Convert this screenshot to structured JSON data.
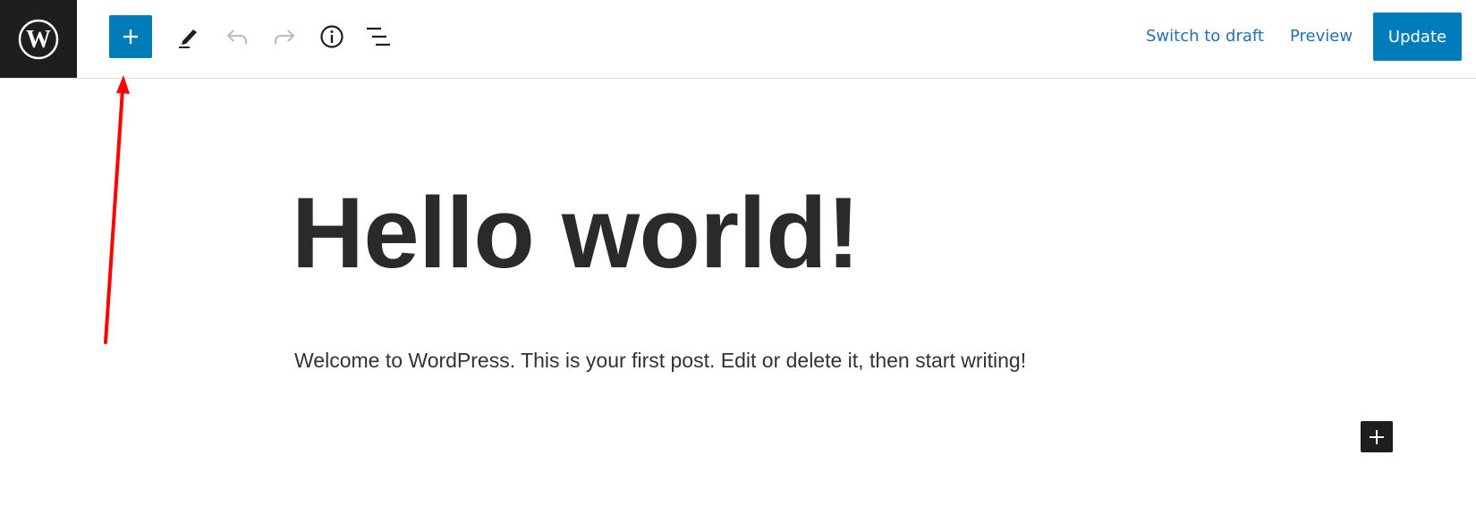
{
  "header": {
    "logo_icon": "wordpress-logo-icon",
    "tools": [
      {
        "name": "block-inserter",
        "icon": "plus-icon"
      },
      {
        "name": "tools",
        "icon": "pencil-icon"
      },
      {
        "name": "undo",
        "icon": "undo-icon",
        "disabled": true
      },
      {
        "name": "redo",
        "icon": "redo-icon",
        "disabled": true
      },
      {
        "name": "details",
        "icon": "info-icon"
      },
      {
        "name": "list-view",
        "icon": "list-view-icon"
      }
    ],
    "switch_to_draft_label": "Switch to draft",
    "preview_label": "Preview",
    "update_label": "Update"
  },
  "post": {
    "title": "Hello world!",
    "paragraph": "Welcome to WordPress. This is your first post. Edit or delete it, then start writing!"
  },
  "colors": {
    "accent": "#007cba",
    "link": "#2271b1",
    "dark": "#1e1e1e",
    "annotation_arrow": "#ff0000"
  }
}
